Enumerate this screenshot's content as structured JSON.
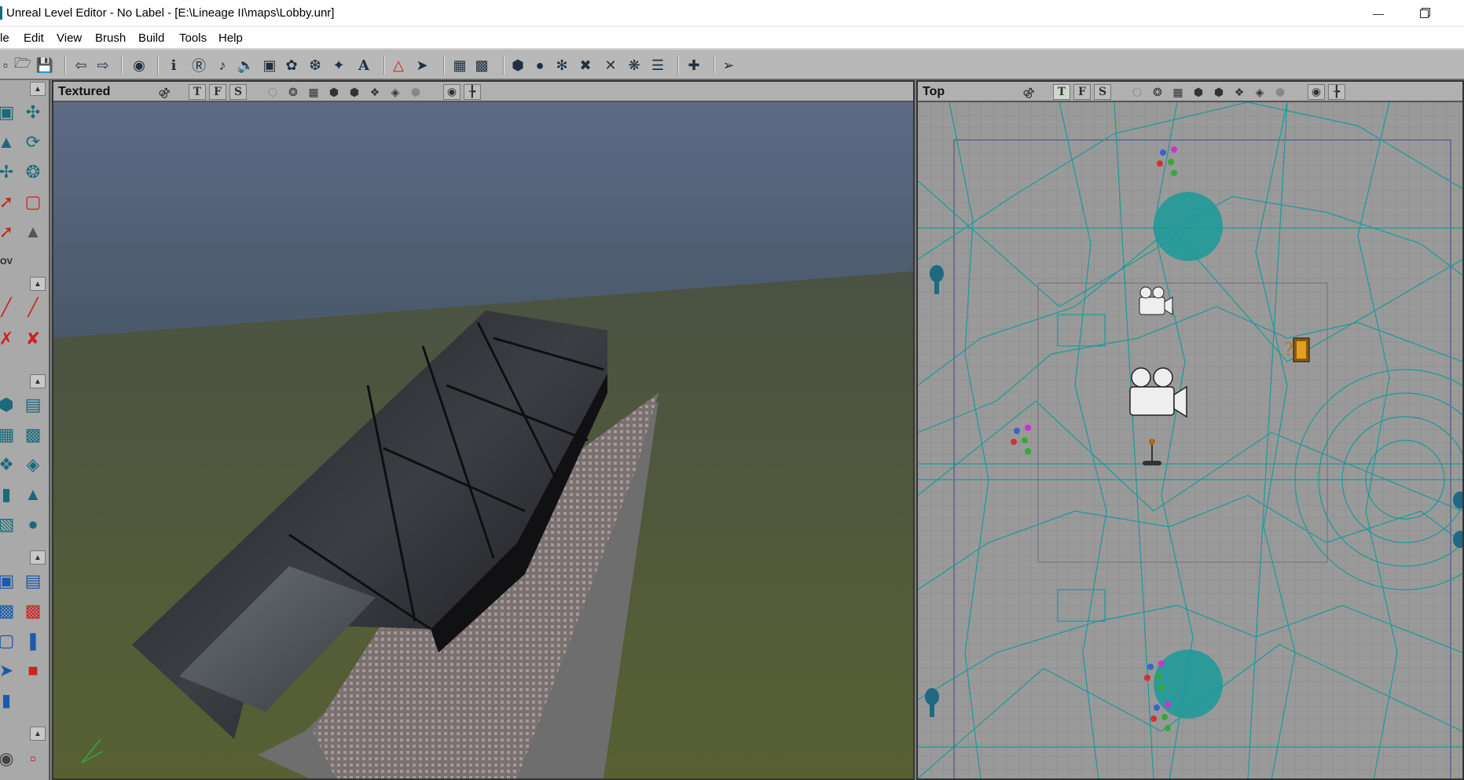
{
  "window": {
    "title": "Unreal Level Editor - No Label - [E:\\Lineage II\\maps\\Lobby.unr]",
    "minimize_icon": "minimize-icon",
    "restore_icon": "restore-icon"
  },
  "menu": {
    "items": [
      "le",
      "Edit",
      "View",
      "Brush",
      "Build",
      "Tools",
      "Help"
    ]
  },
  "viewports": {
    "textured": {
      "label": "Textured",
      "mode_letters": [
        "T",
        "F",
        "S"
      ]
    },
    "top": {
      "label": "Top",
      "mode_letters": [
        "T",
        "F",
        "S"
      ]
    }
  },
  "sidebar": {
    "label_ov": "OV"
  },
  "colors": {
    "wireframe": "#1a9a9a",
    "accent_red": "#cc2222",
    "toolbar": "#b8b8b8",
    "grid_bg": "#9a9a9a"
  }
}
